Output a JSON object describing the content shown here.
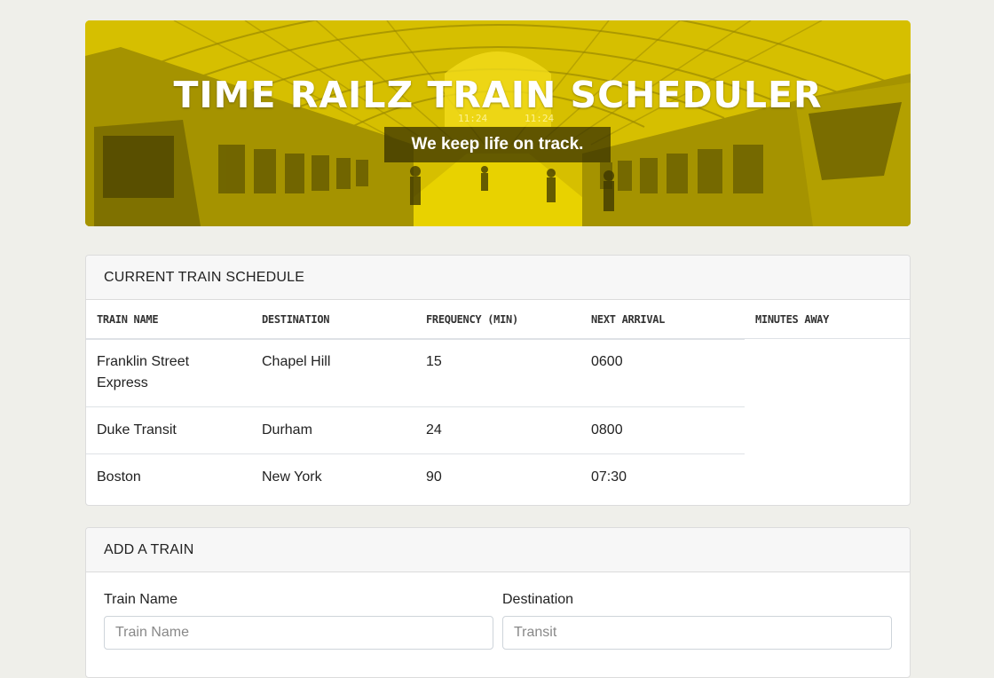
{
  "hero": {
    "title": "TIME RAILZ TRAIN SCHEDULER",
    "tagline": "We keep life on track.",
    "clock_text_1": "11:24",
    "clock_text_2": "11:24"
  },
  "schedule": {
    "header": "CURRENT TRAIN SCHEDULE",
    "columns": [
      "TRAIN NAME",
      "DESTINATION",
      "FREQUENCY (MIN)",
      "NEXT ARRIVAL",
      "MINUTES AWAY"
    ],
    "rows": [
      {
        "name": "Franklin Street Express",
        "destination": "Chapel Hill",
        "frequency": "15",
        "next_arrival": "0600"
      },
      {
        "name": "Duke Transit",
        "destination": "Durham",
        "frequency": "24",
        "next_arrival": "0800"
      },
      {
        "name": "Boston",
        "destination": "New York",
        "frequency": "90",
        "next_arrival": "07:30"
      }
    ]
  },
  "add_train": {
    "header": "ADD A TRAIN",
    "train_name_label": "Train Name",
    "train_name_placeholder": "Train Name",
    "destination_label": "Destination",
    "destination_placeholder": "Transit"
  },
  "colors": {
    "hero_yellow": "#d8c100",
    "page_bg": "#efefea",
    "card_header_bg": "#f7f7f7"
  }
}
